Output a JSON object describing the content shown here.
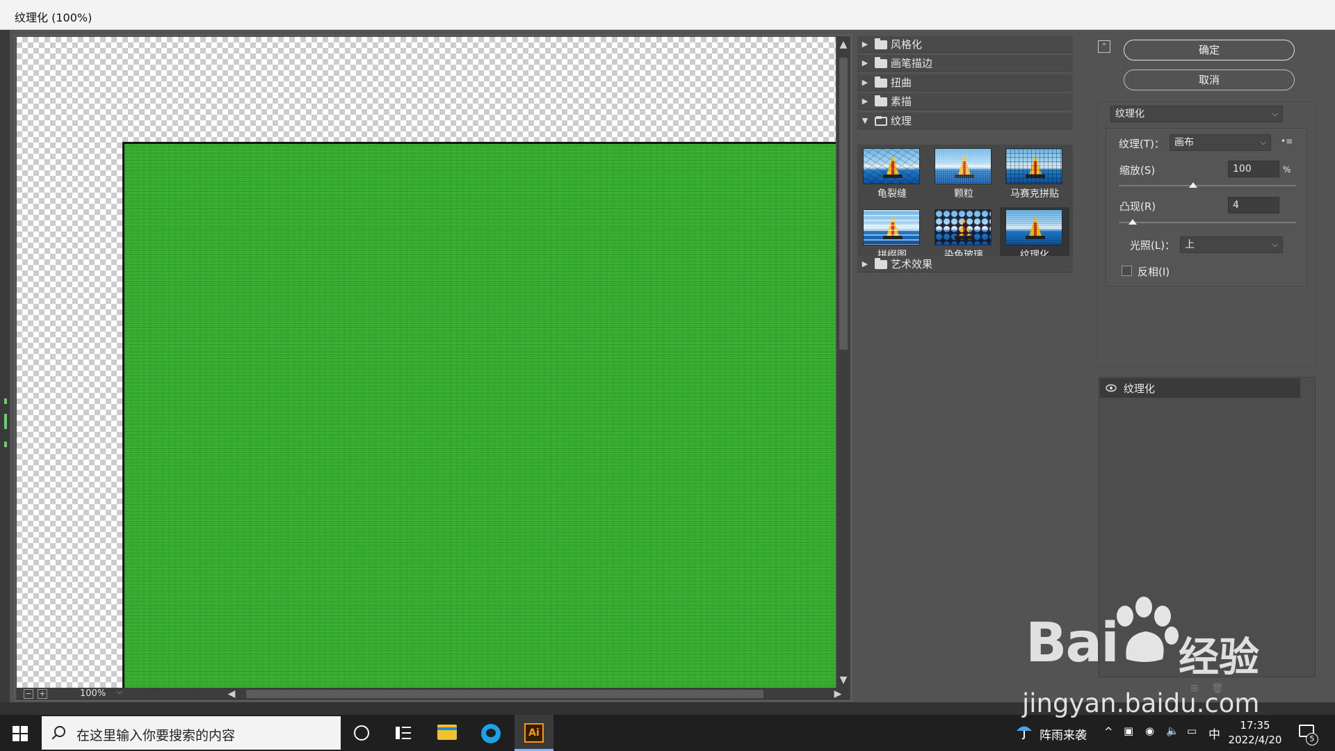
{
  "window": {
    "title": "纹理化 (100%)"
  },
  "preview": {
    "zoom_label": "100%",
    "zoom_out_symbol": "−",
    "zoom_in_symbol": "+",
    "dropdown_symbol": "⌵"
  },
  "gallery": {
    "categories_top": [
      {
        "label": "风格化",
        "expanded": false
      },
      {
        "label": "画笔描边",
        "expanded": false
      },
      {
        "label": "扭曲",
        "expanded": false
      },
      {
        "label": "素描",
        "expanded": false
      },
      {
        "label": "纹理",
        "expanded": true
      }
    ],
    "thumbnails": [
      {
        "label": "龟裂缝",
        "texture": "crack"
      },
      {
        "label": "颗粒",
        "texture": "grain"
      },
      {
        "label": "马赛克拼贴",
        "texture": "mosaic"
      },
      {
        "label": "拼缀图",
        "texture": "patch"
      },
      {
        "label": "染色玻璃",
        "texture": "glass"
      },
      {
        "label": "纹理化",
        "texture": "texture",
        "selected": true
      }
    ],
    "category_bottom": {
      "label": "艺术效果",
      "expanded": false
    }
  },
  "settings": {
    "ok_label": "确定",
    "cancel_label": "取消",
    "filter_select": "纹理化",
    "texture_label": "纹理(T)：",
    "texture_value": "画布",
    "scaling_label": "缩放(S)",
    "scaling_value": "100",
    "scaling_unit": "%",
    "scaling_fraction": 0.42,
    "relief_label": "凸现(R)",
    "relief_value": "4",
    "relief_fraction": 0.08,
    "light_label": "光照(L)：",
    "light_value": "上",
    "invert_label": "反相(I)",
    "invert_checked": false
  },
  "layers": {
    "items": [
      {
        "label": "纹理化",
        "visible": true
      }
    ]
  },
  "taskbar": {
    "search_placeholder": "在这里输入你要搜索的内容",
    "ai_label": "Ai",
    "weather_text": "阵雨来袭",
    "ime": "中",
    "time": "17:35",
    "date": "2022/4/20",
    "notification_count": "5"
  },
  "watermark": {
    "brand": "Bai",
    "brand_cn": "经验",
    "url": "jingyan.baidu.com"
  },
  "colors": {
    "canvas_fill": "#34ad2d",
    "panel_bg": "#535353",
    "taskbar_bg": "#1f1f1f"
  }
}
